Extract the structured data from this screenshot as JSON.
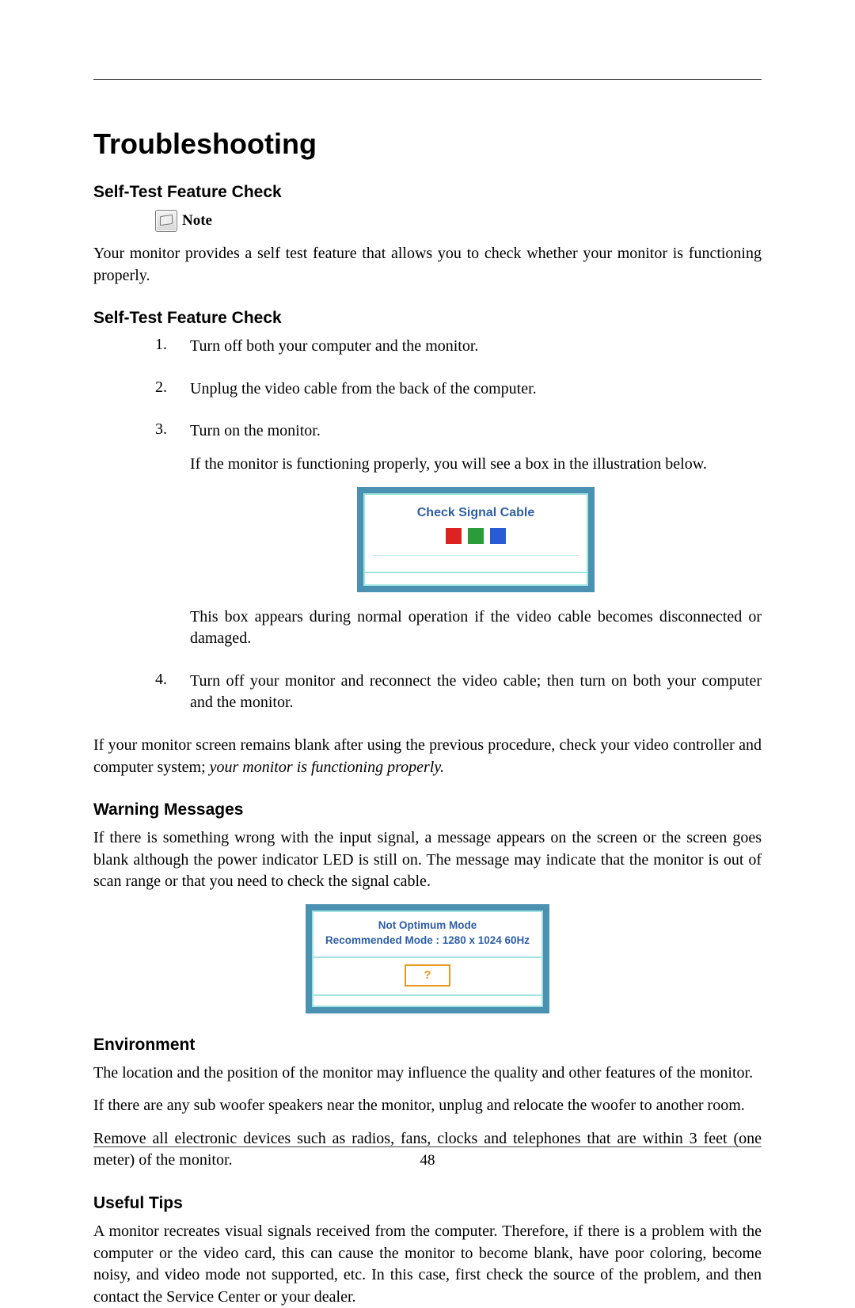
{
  "page_number": "48",
  "title": "Troubleshooting",
  "sec1": {
    "heading": "Self-Test Feature Check",
    "note_label": "Note",
    "p1": "Your monitor provides a self test feature that allows you to check whether your monitor is functioning properly."
  },
  "sec2": {
    "heading": "Self-Test Feature Check",
    "steps": {
      "n1": "1.",
      "t1": "Turn off both your computer and the monitor.",
      "n2": "2.",
      "t2": "Unplug the video cable from the back of the computer.",
      "n3": "3.",
      "t3": "Turn on the monitor.",
      "t3sub": "If the monitor is functioning properly, you will see a box in the illustration below.",
      "t3sub2": "This box appears during normal operation if the video cable becomes disconnected or damaged.",
      "n4": "4.",
      "t4": "Turn off your monitor and reconnect the video cable; then turn on both your computer and the monitor."
    },
    "illA_text": "Check Signal Cable",
    "closing_a": "If your monitor screen remains blank after using the previous procedure, check your video controller and computer system; ",
    "closing_b": "your monitor is functioning properly."
  },
  "sec3": {
    "heading": "Warning Messages",
    "p1": "If there is something wrong with the input signal, a message appears on the screen or the screen goes blank although the power indicator LED is still on. The message may indicate that the monitor is out of scan range or that you need to check the signal cable.",
    "illB_line1": "Not Optimum Mode",
    "illB_line2": "Recommended Mode : 1280 x 1024  60Hz",
    "illB_btn": "?"
  },
  "sec4": {
    "heading": "Environment",
    "p1": "The location and the position of the monitor may influence the quality and other features of the monitor.",
    "p2": "If there are any sub woofer speakers near the monitor, unplug and relocate the woofer to another room.",
    "p3": "Remove all electronic devices such as radios, fans, clocks and telephones that are within 3 feet (one meter) of the monitor."
  },
  "sec5": {
    "heading": "Useful Tips",
    "p1": "A monitor recreates visual signals received from the computer. Therefore, if there is a problem with the computer or the video card, this can cause the monitor to become blank, have poor coloring, become noisy, and video mode not supported, etc. In this case, first check the source of the problem, and then contact the Service Center or your dealer."
  }
}
